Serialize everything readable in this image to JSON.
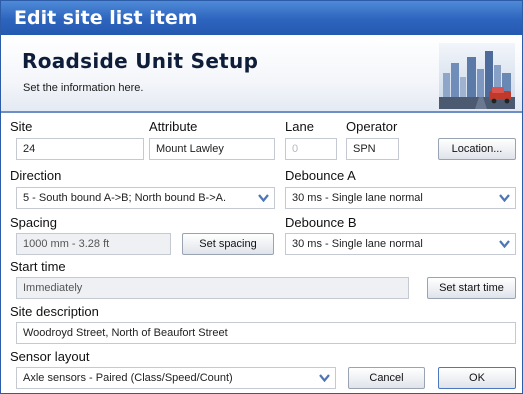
{
  "window": {
    "title": "Edit site list item"
  },
  "banner": {
    "title": "Roadside Unit Setup",
    "subtitle": "Set the information here."
  },
  "site": {
    "label": "Site",
    "value": "24"
  },
  "attribute": {
    "label": "Attribute",
    "value": "Mount Lawley"
  },
  "lane": {
    "label": "Lane",
    "value": "0"
  },
  "operator": {
    "label": "Operator",
    "value": "SPN"
  },
  "location_button": "Location...",
  "direction": {
    "label": "Direction",
    "value": "5 - South bound A->B; North bound B->A."
  },
  "debounce_a": {
    "label": "Debounce A",
    "value": "30 ms - Single lane normal"
  },
  "spacing": {
    "label": "Spacing",
    "value": "1000 mm - 3.28 ft",
    "button": "Set spacing"
  },
  "debounce_b": {
    "label": "Debounce B",
    "value": "30 ms - Single lane normal"
  },
  "start_time": {
    "label": "Start time",
    "value": "Immediately",
    "button": "Set start time"
  },
  "site_description": {
    "label": "Site description",
    "value": "Woodroyd Street, North of Beaufort Street"
  },
  "sensor_layout": {
    "label": "Sensor layout",
    "value": "Axle sensors - Paired (Class/Speed/Count)"
  },
  "buttons": {
    "cancel": "Cancel",
    "ok": "OK"
  },
  "icons": {
    "dropdown": "chevron-down-icon",
    "banner": "city-skyline-image"
  },
  "colors": {
    "title_bar": "#2d64bd",
    "dropdown_arrow": "#4e75b4",
    "banner_rule": "#6d8fc4"
  }
}
